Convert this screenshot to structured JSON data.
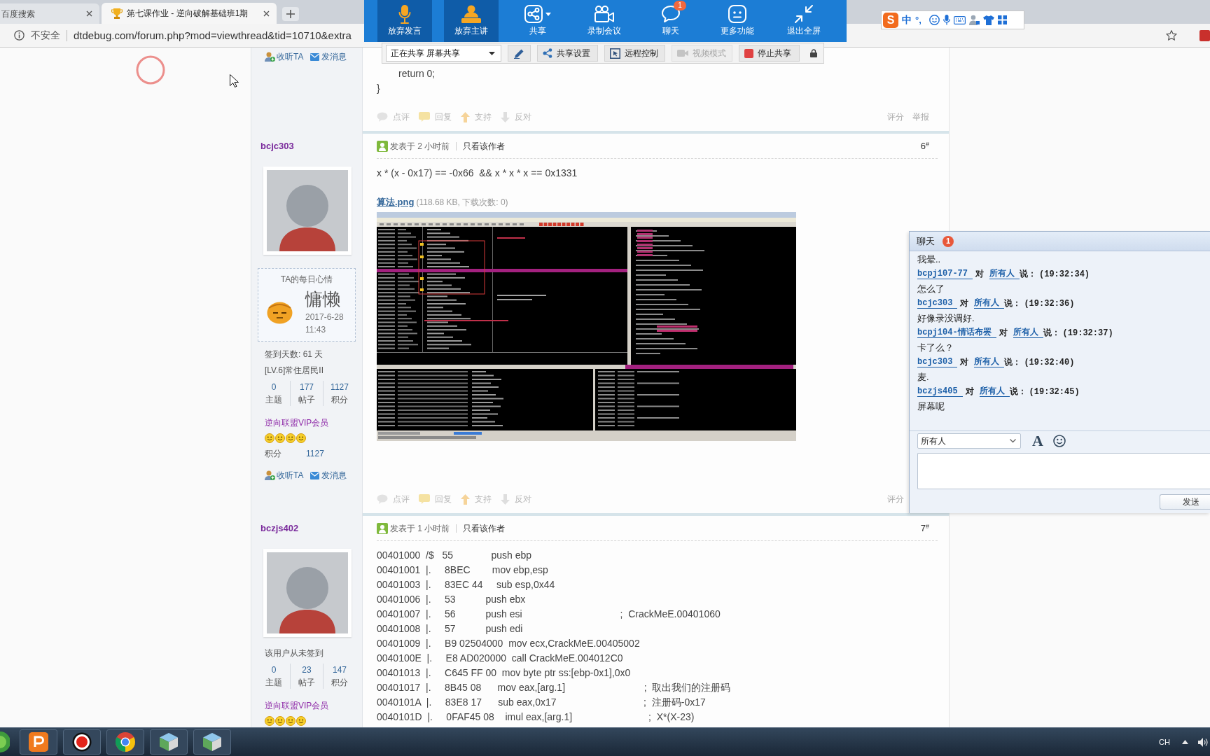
{
  "browser": {
    "tabs": [
      {
        "title": "百度搜索",
        "selected": false
      },
      {
        "title": "第七课作业 - 逆向破解基础班1期",
        "selected": true
      }
    ],
    "security": "不安全",
    "url": "dtdebug.com/forum.php?mod=viewthread&tid=10710&extra"
  },
  "ime": {
    "logo": "S",
    "mode": "中",
    "punctuation": "°,"
  },
  "meeting_toolbar": {
    "items": [
      {
        "label": "放弃发言",
        "on": true,
        "dropdown": false
      },
      {
        "label": "放弃主讲",
        "on": true,
        "dropdown": false
      },
      {
        "label": "共享",
        "on": false,
        "dropdown": true
      },
      {
        "label": "录制会议",
        "on": false,
        "dropdown": false
      },
      {
        "label": "聊天",
        "on": false,
        "dropdown": false,
        "badge": "1"
      },
      {
        "label": "更多功能",
        "on": false,
        "dropdown": false
      },
      {
        "label": "退出全屏",
        "on": false,
        "dropdown": false
      }
    ]
  },
  "share_bar": {
    "status": "正在共享 屏幕共享",
    "buttons": [
      {
        "label": "共享设置",
        "disabled": false
      },
      {
        "label": "远程控制",
        "disabled": false
      },
      {
        "label": "视频模式",
        "disabled": true
      },
      {
        "label": "停止共享",
        "disabled": false
      }
    ]
  },
  "posts": [
    {
      "author": {
        "links": [
          "收听TA",
          "发消息"
        ]
      },
      "body": [
        "        return 0;",
        "}"
      ],
      "actions": [
        "点评",
        "回复",
        "支持",
        "反对"
      ],
      "side_actions": [
        "评分",
        "举报"
      ]
    },
    {
      "author": {
        "name": "bcjc303",
        "mood": {
          "title": "TA的每日心情",
          "mood": "慵懒",
          "date": "2017-6-28",
          "time": "11:43"
        },
        "checkin": "签到天数: 61 天",
        "level": "[LV.6]常住居民II",
        "stats": [
          {
            "value": "0",
            "label": "主题"
          },
          {
            "value": "177",
            "label": "帖子"
          },
          {
            "value": "1127",
            "label": "积分"
          }
        ],
        "group": "逆向联盟VIP会员",
        "stars": 4,
        "points": {
          "label": "积分",
          "value": "1127"
        },
        "links": [
          "收听TA",
          "发消息"
        ]
      },
      "header": {
        "posted": "发表于 2 小时前",
        "filter": "只看该作者",
        "floor": "6$^{#}$"
      },
      "text": "x * (x - 0x17) == -0x66  && x * x * x == 0x1331",
      "attachment": {
        "name": "算法.png",
        "meta": "(118.68 KB, 下载次数: 0)"
      },
      "actions": [
        "点评",
        "回复",
        "支持",
        "反对"
      ],
      "side_actions": [
        "评分"
      ]
    },
    {
      "author": {
        "name": "bczjs402",
        "checkin": "该用户从未签到",
        "stats": [
          {
            "value": "0",
            "label": "主题"
          },
          {
            "value": "23",
            "label": "帖子"
          },
          {
            "value": "147",
            "label": "积分"
          }
        ],
        "group": "逆向联盟VIP会员",
        "stars": 4
      },
      "header": {
        "posted": "发表于 1 小时前",
        "filter": "只看该作者",
        "floor": "7$^{#}$"
      },
      "code_lines": [
        "00401000  /$   55              push ebp",
        "00401001  |.     8BEC        mov ebp,esp",
        "00401003  |.     83EC 44     sub esp,0x44",
        "00401006  |.     53           push ebx",
        "00401007  |.     56           push esi                                    ;  CrackMeE.00401060",
        "00401008  |.     57           push edi",
        "00401009  |.     B9 02504000  mov ecx,CrackMeE.00405002",
        "0040100E  |.     E8 AD020000  call CrackMeE.004012C0",
        "00401013  |.     C645 FF 00  mov byte ptr ss:[ebp-0x1],0x0",
        "00401017  |.     8B45 08      mov eax,[arg.1]                             ;  取出我们的注册码",
        "0040101A  |.     83E8 17      sub eax,0x17                                ;  注册码-0x17",
        "0040101D  |.     0FAF45 08    imul eax,[arg.1]                            ;  X*(X-23)"
      ]
    }
  ],
  "chat": {
    "title": "聊天",
    "badge": "1",
    "lines": [
      {
        "kind": "text",
        "text": "我晕.."
      },
      {
        "kind": "header",
        "sender": "bcpj107-77",
        "to": "对",
        "target": "所有人",
        "said": "说：",
        "time": "(19:32:34)"
      },
      {
        "kind": "text",
        "text": "怎么了"
      },
      {
        "kind": "header",
        "sender": "bcjc303",
        "to": "对",
        "target": "所有人",
        "said": "说：",
        "time": "(19:32:36)"
      },
      {
        "kind": "text",
        "text": "好像录没调好."
      },
      {
        "kind": "header",
        "sender": "bcpj104-情话布罢",
        "to": "对",
        "target": "所有人",
        "said": "说：",
        "time": "(19:32:37)"
      },
      {
        "kind": "text",
        "text": "卡了么？"
      },
      {
        "kind": "header",
        "sender": "bcjc303",
        "to": "对",
        "target": "所有人",
        "said": "说：",
        "time": "(19:32:40)"
      },
      {
        "kind": "text",
        "text": "麦."
      },
      {
        "kind": "header",
        "sender": "bczjs405",
        "to": "对",
        "target": "所有人",
        "said": "说：",
        "time": "(19:32:45)"
      },
      {
        "kind": "text",
        "text": "屏幕呢"
      }
    ],
    "recipient": "所有人",
    "font_button": "A",
    "send": "发送"
  },
  "taskbar": {
    "language": "CH"
  }
}
